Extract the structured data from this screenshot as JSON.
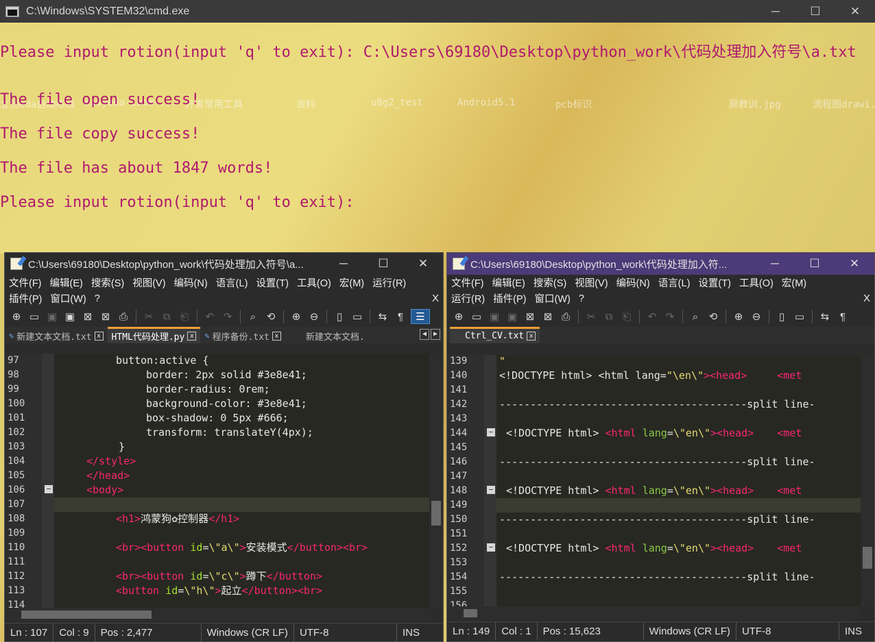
{
  "cmd": {
    "title": "C:\\Windows\\SYSTEM32\\cmd.exe",
    "lines": [
      "Please input rotion(input 'q' to exit): C:\\Users\\69180\\Desktop\\python_work\\代码处理加入符号\\a.txt",
      "The file open success!",
      "The file copy success!",
      "The file has about 1847 words!",
      "Please input rotion(input 'q' to exit):"
    ],
    "desktop_labels": [
      "立创eda自动布线",
      "easyeda-ibom-...",
      "开发常用工具",
      "资料",
      "u8g2_test",
      "Android5.1",
      "pcb标识",
      "屏教训.jpg",
      "流程图drawi..."
    ],
    "text_color": "#b0196e"
  },
  "win_controls": {
    "minimize": "─",
    "maximize": "☐",
    "close": "✕"
  },
  "left": {
    "title": "C:\\Users\\69180\\Desktop\\python_work\\代码处理加入符号\\a...",
    "menu_row1": [
      "文件(F)",
      "编辑(E)",
      "搜索(S)",
      "视图(V)",
      "编码(N)",
      "语言(L)",
      "设置(T)",
      "工具(O)",
      "宏(M)",
      "运行(R)"
    ],
    "menu_row2": [
      "插件(P)",
      "窗口(W)",
      "?"
    ],
    "menu_close": "X",
    "tabs": [
      "新建文本文档.txt",
      "HTML代码处理.py",
      "程序备份.txt",
      "新建文本文档."
    ],
    "tab_close": "x",
    "line_numbers": [
      "97",
      "98",
      "99",
      "100",
      "101",
      "102",
      "103",
      "104",
      "105",
      "106",
      "107",
      "108",
      "109",
      "110",
      "111",
      "112",
      "113",
      "114"
    ],
    "status": {
      "ln": "Ln : 107",
      "col": "Col : 9",
      "pos": "Pos : 2,477",
      "eol": "Windows (CR LF)",
      "enc": "UTF-8",
      "mode": "INS"
    }
  },
  "right": {
    "title": "C:\\Users\\69180\\Desktop\\python_work\\代码处理加入符...",
    "menu_row1": [
      "文件(F)",
      "编辑(E)",
      "搜索(S)",
      "视图(V)",
      "编码(N)",
      "语言(L)",
      "设置(T)",
      "工具(O)",
      "宏(M)"
    ],
    "menu_row2": [
      "运行(R)",
      "插件(P)",
      "窗口(W)",
      "?"
    ],
    "menu_close": "X",
    "tab": "Ctrl_CV.txt",
    "tab_close": "x",
    "line_numbers": [
      "139",
      "140",
      "141",
      "142",
      "143",
      "144",
      "145",
      "146",
      "147",
      "148",
      "149",
      "150",
      "151",
      "152",
      "153",
      "154",
      "155",
      "156"
    ],
    "status": {
      "ln": "Ln : 149",
      "col": "Col : 1",
      "pos": "Pos : 15,623",
      "eol": "Windows (CR LF)",
      "enc": "UTF-8",
      "mode": "INS"
    }
  },
  "code_left": {
    "l97": "button:active {",
    "l98": "border: 2px solid #3e8e41;",
    "l99": "border-radius: 0rem;",
    "l100": "background-color: #3e8e41;",
    "l101": "box-shadow: 0 5px #666;",
    "l102": "transform: translateY(4px);",
    "l103": "}",
    "l104": "</style>",
    "l105": "</head>",
    "l106": "<body>",
    "l108a": "<h1>",
    "l108b": "鸿蒙狗",
    "l108c": "控制器",
    "l108d": "</h1>",
    "l110a": "<br><button ",
    "l110b": "id",
    "l110c": "=",
    "l110d": "\\\"a\\\"",
    "l110e": ">",
    "l110f": "安装模式",
    "l110g": "</button><br>",
    "l112a": "<br><button ",
    "l112b": "id",
    "l112c": "=",
    "l112d": "\\\"c\\\"",
    "l112e": ">",
    "l112f": "蹲下",
    "l112g": "</button>",
    "l113a": "<button ",
    "l113b": "id",
    "l113c": "=",
    "l113d": "\\\"h\\\"",
    "l113e": ">",
    "l113f": "起立",
    "l113g": "</button><br>"
  },
  "code_right": {
    "l139": "\"",
    "l140a": "<!DOCTYPE html> <html lang=",
    "l140b": "\"\\en\\\"",
    "l140c": "><head>",
    "l140d": "<met",
    "split": "----------------------------------------split line-",
    "dt": "<!DOCTYPE html> ",
    "html_tag": "<html ",
    "lang": "lang",
    "eq": "=",
    "lang_val": "\\\"en\\\"",
    "gt_head": "><head>",
    "met": "<met"
  }
}
